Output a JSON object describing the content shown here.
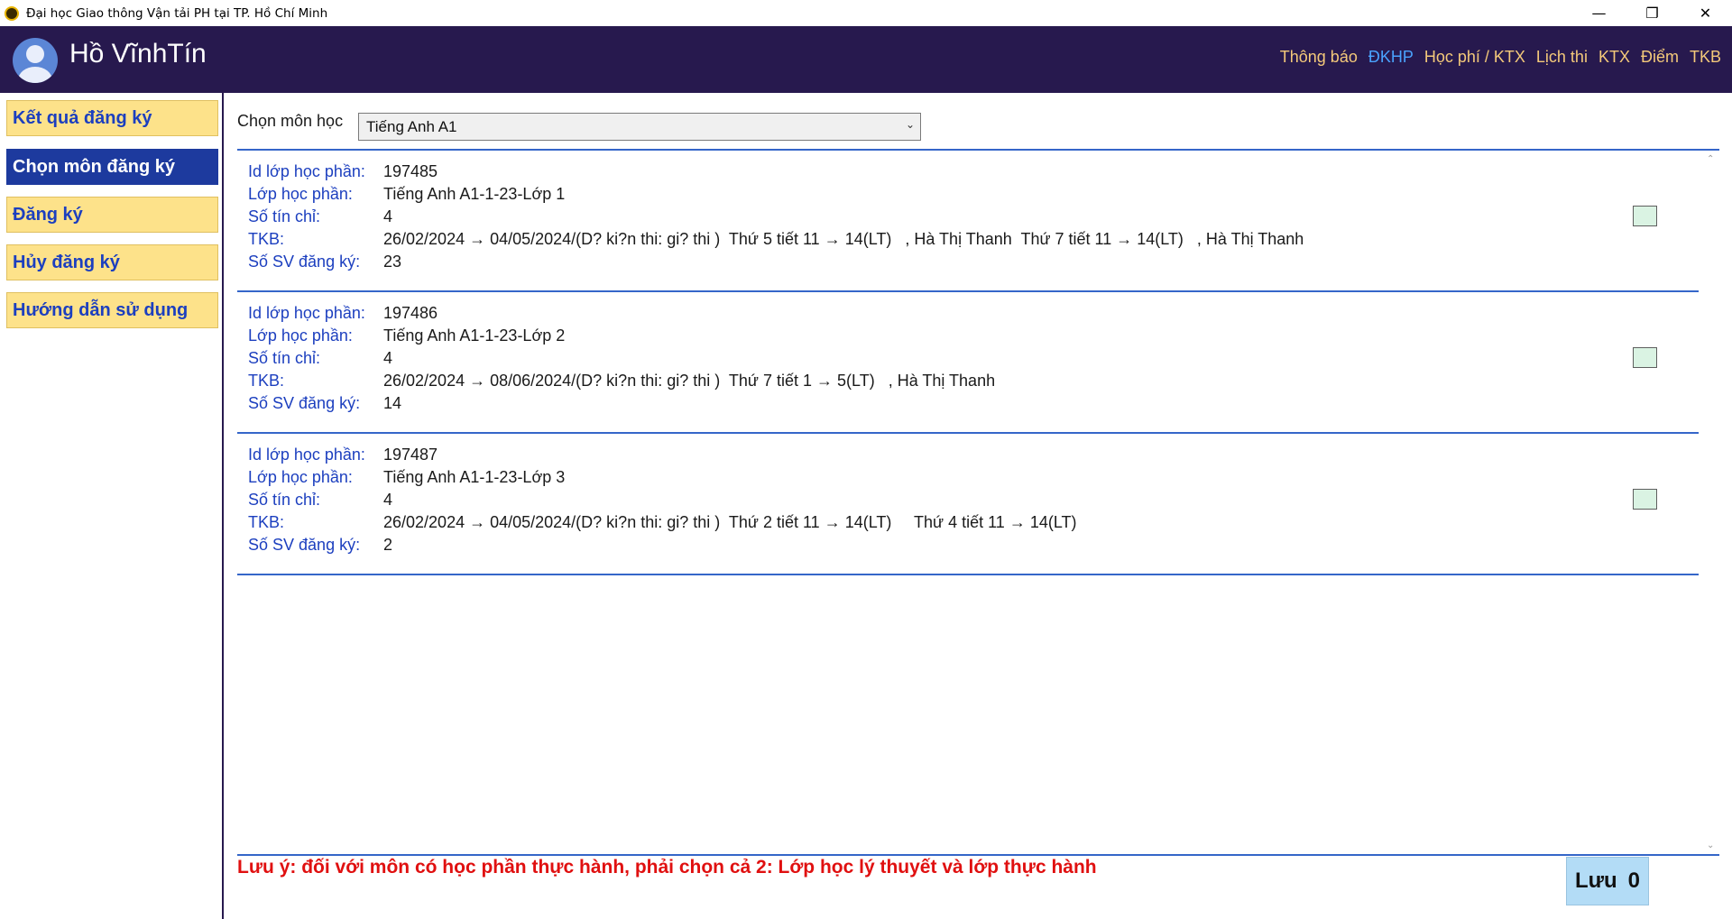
{
  "window": {
    "title": "Đại học Giao thông Vận tải PH tại TP. Hồ Chí Minh",
    "minimize": "—",
    "restore": "❐",
    "close": "✕"
  },
  "header": {
    "user_name": "Hồ VĩnhTín",
    "nav": [
      "Thông báo",
      "ĐKHP",
      "Học phí / KTX",
      "Lịch thi",
      "KTX",
      "Điểm",
      "TKB"
    ],
    "active_nav": "ĐKHP"
  },
  "sidebar": {
    "items": [
      {
        "label": "Kết quả đăng ký"
      },
      {
        "label": "Chọn môn đăng ký"
      },
      {
        "label": "Đăng ký"
      },
      {
        "label": "Hủy đăng ký"
      },
      {
        "label": "Hướng dẫn sử dụng"
      }
    ],
    "active_index": 1
  },
  "main": {
    "choose_label": "Chọn môn học",
    "selected_course": "Tiếng Anh A1",
    "field_labels": {
      "id": "Id lớp học phần:",
      "class": "Lớp học phần:",
      "credits": "Số tín chỉ:",
      "tkb": "TKB:",
      "students": "Số SV đăng ký:"
    },
    "classes": [
      {
        "id": "197485",
        "name": "Tiếng Anh A1-1-23-Lớp 1",
        "credits": "4",
        "tkb": "26/02/2024 → 04/05/2024/(D? ki?n thi: gi? thi )  Thứ 5 tiết 11 → 14(LT)   , Hà Thị Thanh  Thứ 7 tiết 11 → 14(LT)   , Hà Thị Thanh",
        "students": "23",
        "checked": false
      },
      {
        "id": "197486",
        "name": "Tiếng Anh A1-1-23-Lớp 2",
        "credits": "4",
        "tkb": "26/02/2024 → 08/06/2024/(D? ki?n thi: gi? thi )  Thứ 7 tiết 1 → 5(LT)   , Hà Thị Thanh",
        "students": "14",
        "checked": false
      },
      {
        "id": "197487",
        "name": "Tiếng Anh A1-1-23-Lớp 3",
        "credits": "4",
        "tkb": "26/02/2024 → 04/05/2024/(D? ki?n thi: gi? thi )  Thứ 2 tiết 11 → 14(LT)     Thứ 4 tiết 11 → 14(LT)",
        "students": "2",
        "checked": false
      }
    ],
    "note": "Lưu ý: đối với môn có học phần thực hành, phải chọn cả 2: Lớp học lý thuyết và lớp thực hành",
    "save_label": "Lưu",
    "save_count": "0"
  },
  "colors": {
    "header_bg": "#27194e",
    "nav_text": "#f4c97a",
    "nav_active": "#4aa3ff",
    "sidebar_item_bg": "#fde28a",
    "sidebar_active_bg": "#1d3a9e",
    "label_blue": "#1c3fbf",
    "divider_blue": "#3566c9",
    "note_red": "#e01010",
    "save_bg": "#b3dcf6",
    "checkbox_bg": "#daf3e3"
  }
}
